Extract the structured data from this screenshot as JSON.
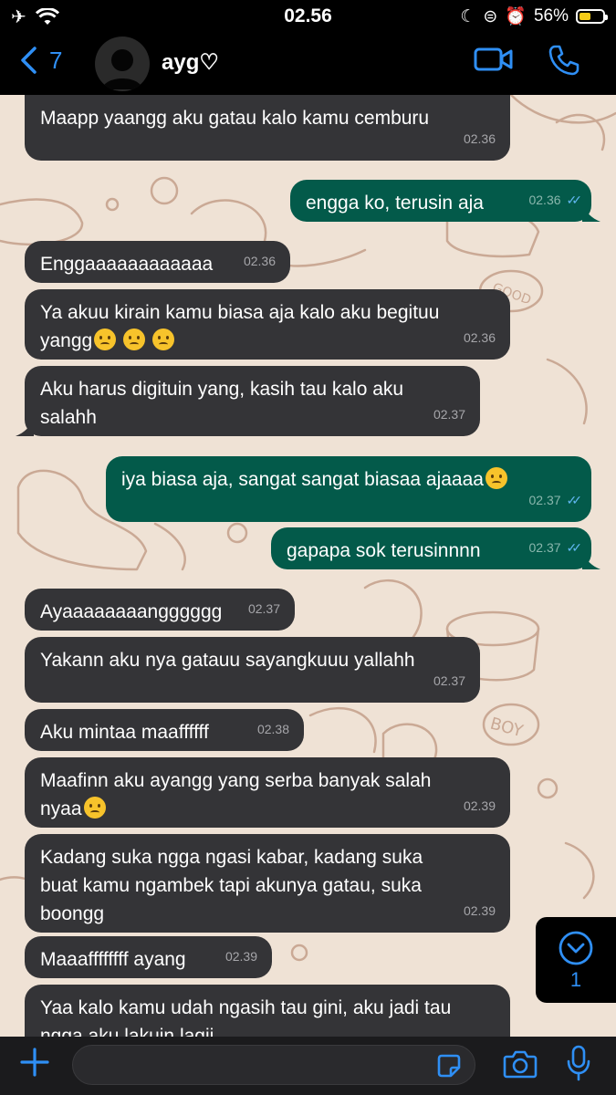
{
  "status_bar": {
    "time": "02.56",
    "battery_percent": "56%",
    "battery_level": 0.56
  },
  "header": {
    "back_count": "7",
    "contact_name": "ayg♡"
  },
  "messages": [
    {
      "dir": "in",
      "lines": [
        "Maapp yaangg aku gatau kalo kamu cemburu"
      ],
      "time": "02.36"
    },
    {
      "dir": "out",
      "lines": [
        "engga ko, terusin aja"
      ],
      "time": "02.36"
    },
    {
      "dir": "in",
      "lines": [
        "Enggaaaaaaaaaaaa"
      ],
      "time": "02.36"
    },
    {
      "dir": "in",
      "lines": [
        "Ya akuu kirain kamu biasa aja kalo aku begituu",
        "yangg"
      ],
      "emoji_count": 3,
      "time": "02.36"
    },
    {
      "dir": "in",
      "lines": [
        "Aku harus digituin yang, kasih tau kalo aku",
        "salahh"
      ],
      "time": "02.37"
    },
    {
      "dir": "out",
      "lines": [
        "iya biasa aja, sangat sangat biasaa ajaaaa"
      ],
      "emoji_count": 1,
      "time": "02.37"
    },
    {
      "dir": "out",
      "lines": [
        "gapapa sok terusinnnn"
      ],
      "time": "02.37"
    },
    {
      "dir": "in",
      "lines": [
        "Ayaaaaaaaangggggg"
      ],
      "time": "02.37"
    },
    {
      "dir": "in",
      "lines": [
        "Yakann aku nya gatauu sayangkuuu yallahh"
      ],
      "time": "02.37"
    },
    {
      "dir": "in",
      "lines": [
        "Aku mintaa maaffffff"
      ],
      "time": "02.38"
    },
    {
      "dir": "in",
      "lines": [
        "Maafinn aku ayangg yang serba banyak salah",
        "nyaa"
      ],
      "emoji_count": 1,
      "time": "02.39"
    },
    {
      "dir": "in",
      "lines": [
        "Kadang suka ngga ngasi kabar, kadang suka",
        "buat kamu ngambek tapi akunya gatau, suka",
        "boongg"
      ],
      "time": "02.39"
    },
    {
      "dir": "in",
      "lines": [
        "Maaaffffffff ayang"
      ],
      "time": "02.39"
    },
    {
      "dir": "in",
      "lines": [
        "Yaa kalo kamu udah ngasih tau gini, aku jadi tau",
        "ngga aku lakuin lagii"
      ],
      "time": ""
    }
  ],
  "scroll_button": {
    "unread_count": "1"
  },
  "input_bar": {
    "placeholder": ""
  },
  "colors": {
    "accent": "#2f8ff5",
    "incoming_bubble": "#343437",
    "outgoing_bubble": "#035a4a",
    "chat_bg": "#efe2d5"
  }
}
